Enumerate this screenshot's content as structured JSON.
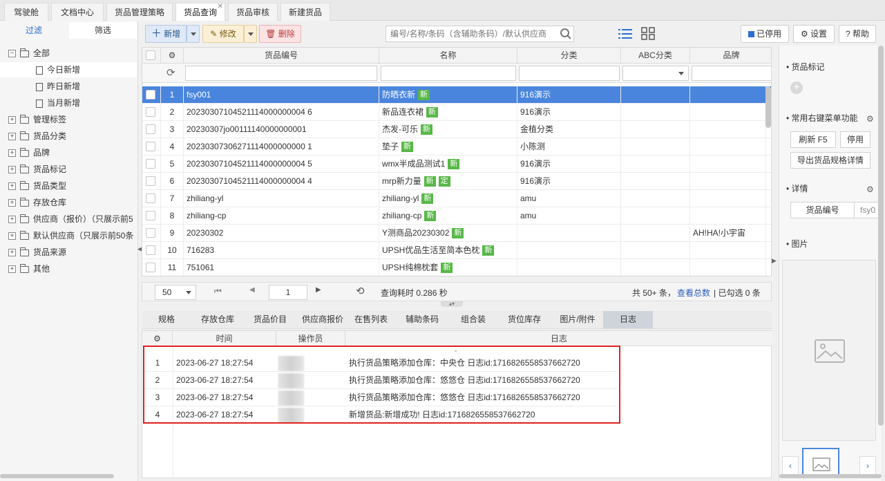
{
  "top_tabs": [
    "驾驶舱",
    "文档中心",
    "货品管理策略",
    "货品查询",
    "货品审核",
    "新建货品"
  ],
  "active_top_tab": "货品查询",
  "sidebar": {
    "tabs": [
      "过滤",
      "筛选"
    ],
    "tree": [
      {
        "label": "全部",
        "kind": "root"
      },
      {
        "label": "今日新增",
        "kind": "doc"
      },
      {
        "label": "昨日新增",
        "kind": "doc"
      },
      {
        "label": "当月新增",
        "kind": "doc"
      },
      {
        "label": "管理标签",
        "kind": "folder"
      },
      {
        "label": "货品分类",
        "kind": "folder"
      },
      {
        "label": "品牌",
        "kind": "folder"
      },
      {
        "label": "货品标记",
        "kind": "folder"
      },
      {
        "label": "货品类型",
        "kind": "folder"
      },
      {
        "label": "存放仓库",
        "kind": "folder"
      },
      {
        "label": "供应商（报价）（只展示前5",
        "kind": "folder"
      },
      {
        "label": "默认供应商（只展示前50条",
        "kind": "folder"
      },
      {
        "label": "货品来源",
        "kind": "folder"
      },
      {
        "label": "其他",
        "kind": "folder"
      }
    ]
  },
  "toolbar": {
    "add": "新增",
    "edit": "修改",
    "delete": "删除",
    "search_placeholder": "编号/名称/条码（含辅助条码）/默认供应商",
    "disabled": "已停用",
    "settings": "设置",
    "help": "帮助"
  },
  "grid": {
    "columns": [
      "货品编号",
      "名称",
      "分类",
      "ABC分类",
      "品牌"
    ],
    "rows": [
      {
        "n": "1",
        "code": "fsy001",
        "name": "防晒衣新",
        "tags": [
          "新"
        ],
        "cat": "916演示",
        "brand": ""
      },
      {
        "n": "2",
        "code": "20230307104521114000000004 6",
        "name": "新品连衣裙",
        "tags": [
          "新"
        ],
        "cat": "916演示",
        "brand": ""
      },
      {
        "n": "3",
        "code": "20230307jo00111140000000001",
        "name": "杰发-可乐",
        "tags": [
          "新"
        ],
        "cat": "金植分类",
        "brand": ""
      },
      {
        "n": "4",
        "code": "20230307306271114000000000 1",
        "name": "垫子",
        "tags": [
          "新"
        ],
        "cat": "小陈测",
        "brand": ""
      },
      {
        "n": "5",
        "code": "20230307104521114000000004 5",
        "name": "wmx半成品测试1",
        "tags": [
          "新"
        ],
        "cat": "916演示",
        "brand": ""
      },
      {
        "n": "6",
        "code": "20230307104521114000000004 4",
        "name": "mrp新力量",
        "tags": [
          "新",
          "定"
        ],
        "cat": "916演示",
        "brand": ""
      },
      {
        "n": "7",
        "code": "zhiliang-yl",
        "name": "zhiliang-yl",
        "tags": [
          "新"
        ],
        "cat": "amu",
        "brand": ""
      },
      {
        "n": "8",
        "code": "zhiliang-cp",
        "name": "zhiliang-cp",
        "tags": [
          "新"
        ],
        "cat": "amu",
        "brand": ""
      },
      {
        "n": "9",
        "code": "20230302",
        "name": "Y测商品20230302",
        "tags": [
          "新"
        ],
        "cat": "",
        "brand": "AH!HA!小宇宙"
      },
      {
        "n": "10",
        "code": "716283",
        "name": "UPSH优品生活至简本色枕",
        "tags": [
          "新"
        ],
        "cat": "",
        "brand": ""
      },
      {
        "n": "11",
        "code": "751061",
        "name": "UPSH纯棉枕套",
        "tags": [
          "新"
        ],
        "cat": "",
        "brand": ""
      }
    ]
  },
  "pager": {
    "page_size": "50",
    "page": "1",
    "query_time": "查询耗时 0.286 秒",
    "total": "共 50+ 条，",
    "view_total": "查看总数",
    "selected": "| 已勾选 0 条"
  },
  "bottom_tabs": [
    "规格",
    "存放仓库",
    "货品价目",
    "供应商报价",
    "在售列表",
    "辅助条码",
    "组合装",
    "货位库存",
    "图片/附件",
    "日志"
  ],
  "active_bottom_tab": "日志",
  "log": {
    "columns": [
      "时间",
      "操作员",
      "日志"
    ],
    "rows": [
      {
        "n": "1",
        "time": "2023-06-27 18:27:54",
        "msg": "执行货品策略添加仓库：中央仓 日志id:1716826558537662720"
      },
      {
        "n": "2",
        "time": "2023-06-27 18:27:54",
        "msg": "执行货品策略添加仓库：悠悠仓 日志id:1716826558537662720"
      },
      {
        "n": "3",
        "time": "2023-06-27 18:27:54",
        "msg": "执行货品策略添加仓库：悠悠仓 日志id:1716826558537662720"
      },
      {
        "n": "4",
        "time": "2023-06-27 18:27:54",
        "msg": "新增货品:新增成功! 日志id:1716826558537662720"
      }
    ]
  },
  "right_panel": {
    "mark": "货品标记",
    "context": "常用右键菜单功能",
    "refresh": "刷新 F5",
    "disable": "停用",
    "export": "导出货品规格详情",
    "details": "详情",
    "detail_key": "货品编号",
    "detail_val": "fsy0",
    "image": "图片"
  },
  "colors": {
    "selected_row": "#4a85dd",
    "tag_green": "#57b847",
    "highlight_box": "#e02020"
  }
}
